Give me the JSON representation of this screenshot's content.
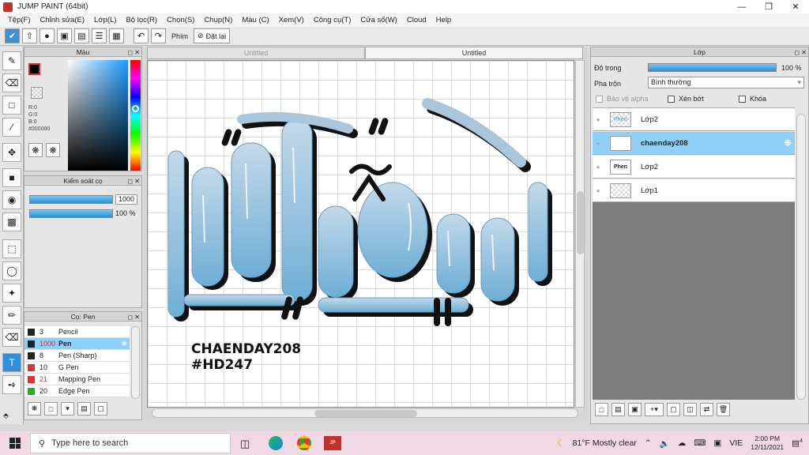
{
  "window": {
    "title": "JUMP PAINT (64bit)"
  },
  "menu": [
    "Tệp(F)",
    "Chỉnh sửa(E)",
    "Lớp(L)",
    "Bộ lọc(R)",
    "Chọn(S)",
    "Chụp(N)",
    "Màu (C)",
    "Xem(V)",
    "Công cụ(T)",
    "Cửa sổ(W)",
    "Cloud",
    "Help"
  ],
  "toolbar": {
    "key_label": "Phím",
    "reset_label": "Đặt lại"
  },
  "color_panel": {
    "title": "Màu",
    "r": "R:0",
    "g": "G:0",
    "b": "B:0",
    "hex": "#000000"
  },
  "brush_control": {
    "title": "Kiểm soát cọ",
    "size_value": "1000",
    "opacity_value": "100 %"
  },
  "brush_panel": {
    "title": "Cọ: Pen",
    "brushes": [
      {
        "size": "3",
        "name": "Pencil",
        "color": "#222222"
      },
      {
        "size": "1000",
        "name": "Pen",
        "color": "#222222",
        "selected": true
      },
      {
        "size": "8",
        "name": "Pen (Sharp)",
        "color": "#222222"
      },
      {
        "size": "10",
        "name": "G Pen",
        "color": "#e03030"
      },
      {
        "size": "21",
        "name": "Mapping Pen",
        "color": "#e03030"
      },
      {
        "size": "20",
        "name": "Edge Pen",
        "color": "#20b020"
      }
    ]
  },
  "tabs": [
    "Untitled",
    "Untitled"
  ],
  "canvas": {
    "signature_line1": "CHAENDAY208",
    "signature_line2": "#HD247"
  },
  "layer_panel": {
    "title": "Lớp",
    "opacity_label": "Độ trong",
    "opacity_value": "100 %",
    "blend_label": "Pha trộn",
    "blend_value": "Bình thường",
    "protect_alpha": "Bảo vệ alpha",
    "clip": "Xén bớt",
    "lock": "Khóa",
    "layers": [
      {
        "name": "Lớp2",
        "thumb": "Phen",
        "selected": false
      },
      {
        "name": "chaenday208",
        "thumb": "",
        "selected": true
      },
      {
        "name": "Lớp2",
        "thumb": "Phen",
        "selected": false
      },
      {
        "name": "Lớp1",
        "thumb": "",
        "selected": false
      }
    ]
  },
  "taskbar": {
    "search_placeholder": "Type here to search",
    "weather": "81°F  Mostly clear",
    "language": "VIE",
    "time": "2:00 PM",
    "date": "12/11/2021",
    "notifications": "4"
  }
}
